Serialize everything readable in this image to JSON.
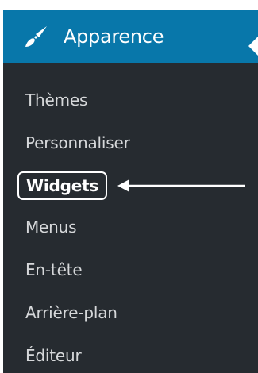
{
  "menu": {
    "header_label": "Apparence",
    "header_icon": "paintbrush-icon",
    "accent_color": "#0877aa",
    "background_color": "#262b30",
    "items": [
      {
        "label": "Thèmes"
      },
      {
        "label": "Personnaliser"
      },
      {
        "label": "Widgets",
        "current": true
      },
      {
        "label": "Menus"
      },
      {
        "label": "En-tête"
      },
      {
        "label": "Arrière-plan"
      },
      {
        "label": "Éditeur"
      }
    ]
  }
}
